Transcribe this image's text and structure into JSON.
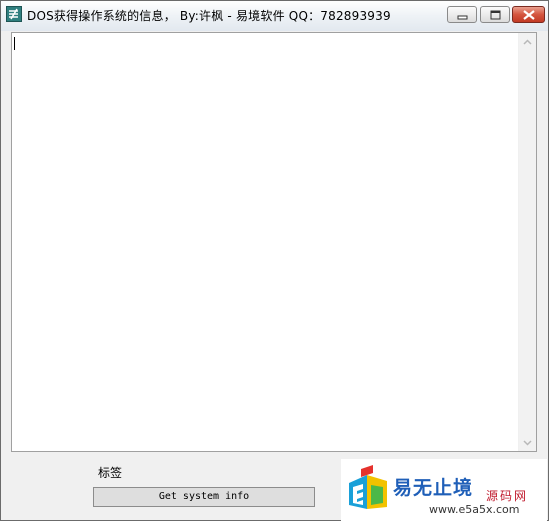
{
  "window": {
    "title": "DOS获得操作系统的信息，   By:许枫 - 易境软件    QQ：782893939"
  },
  "titlebar": {
    "controls": [
      "minimize",
      "maximize",
      "close"
    ]
  },
  "form": {
    "label": "标签",
    "button_label": "Get system info"
  },
  "watermark": {
    "brand_cn": "易无止境",
    "brand_sub": "源码网",
    "url": "www.e5a5x.com"
  },
  "colors": {
    "close_button": "#c8442f",
    "accent_blue": "#1f5fb8",
    "accent_red": "#c01b2e"
  },
  "icons": [
    "app-icon",
    "minimize-icon",
    "maximize-icon",
    "close-icon",
    "scroll-up-icon",
    "scroll-down-icon",
    "e5a5x-logo"
  ]
}
